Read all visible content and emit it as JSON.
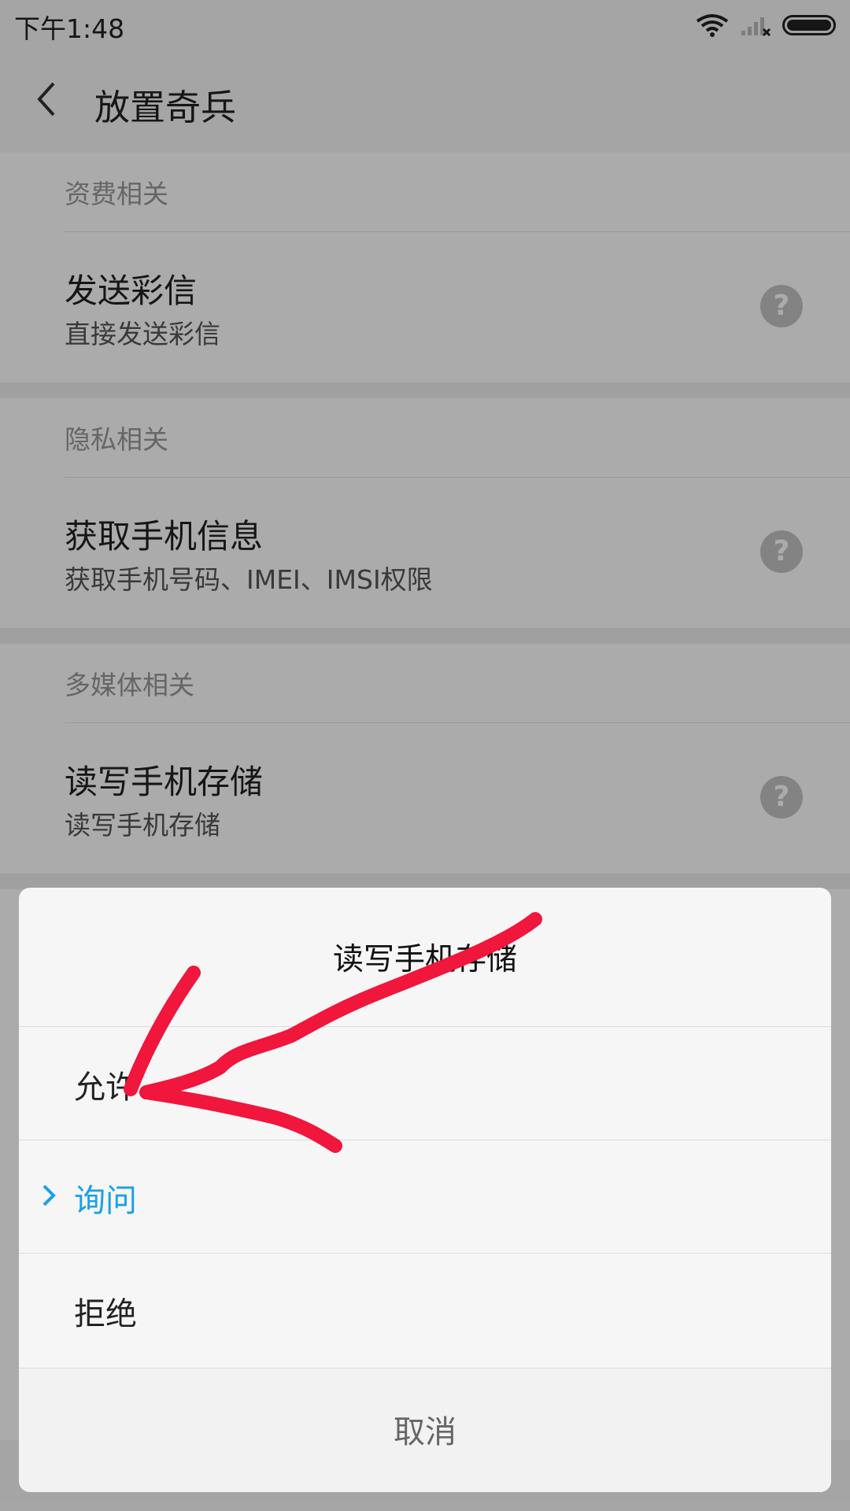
{
  "status_bar": {
    "time": "下午1:48"
  },
  "app": {
    "title": "放置奇兵"
  },
  "sections": [
    {
      "header": "资费相关",
      "item_title": "发送彩信",
      "item_subtitle": "直接发送彩信"
    },
    {
      "header": "隐私相关",
      "item_title": "获取手机信息",
      "item_subtitle": "获取手机号码、IMEI、IMSI权限"
    },
    {
      "header": "多媒体相关",
      "item_title": "读写手机存储",
      "item_subtitle": "读写手机存储"
    }
  ],
  "help_icon_text": "?",
  "dialog": {
    "title": "读写手机存储",
    "options": [
      {
        "label": "允许",
        "selected": false
      },
      {
        "label": "询问",
        "selected": true
      },
      {
        "label": "拒绝",
        "selected": false
      }
    ],
    "cancel_label": "取消"
  },
  "colors": {
    "accent": "#1aa0e6",
    "annotation": "#f0163c"
  },
  "icons": [
    "wifi-icon",
    "signal-icon",
    "battery-icon",
    "back-arrow-icon",
    "help-icon",
    "chevron-right-icon"
  ]
}
